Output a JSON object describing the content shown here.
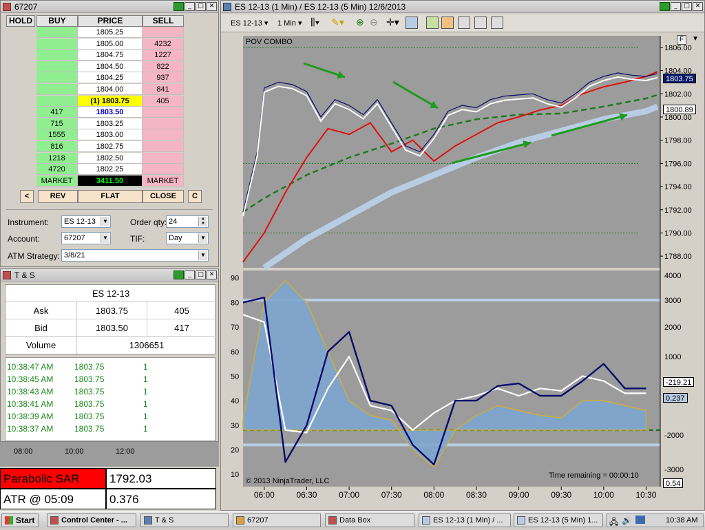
{
  "dom_window": {
    "title": "67207",
    "headers": [
      "HOLD",
      "BUY",
      "PRICE",
      "SELL"
    ],
    "rows": [
      {
        "buy": "",
        "price": "1805.25",
        "sell": ""
      },
      {
        "buy": "",
        "price": "1805.00",
        "sell": "4232"
      },
      {
        "buy": "",
        "price": "1804.75",
        "sell": "1227"
      },
      {
        "buy": "",
        "price": "1804.50",
        "sell": "822"
      },
      {
        "buy": "",
        "price": "1804.25",
        "sell": "937"
      },
      {
        "buy": "",
        "price": "1804.00",
        "sell": "841"
      },
      {
        "buy": "",
        "price": "(1) 1803.75",
        "sell": "405"
      },
      {
        "buy": "417",
        "price": "1803.50",
        "sell": ""
      },
      {
        "buy": "715",
        "price": "1803.25",
        "sell": ""
      },
      {
        "buy": "1555",
        "price": "1803.00",
        "sell": ""
      },
      {
        "buy": "816",
        "price": "1802.75",
        "sell": ""
      },
      {
        "buy": "1218",
        "price": "1802.50",
        "sell": ""
      },
      {
        "buy": "4720",
        "price": "1802.25",
        "sell": ""
      }
    ],
    "market_row": {
      "buy": "MARKET",
      "price": "3411.50",
      "sell": "MARKET"
    },
    "buttons": {
      "left": "<",
      "rev": "REV",
      "flat": "FLAT",
      "close": "CLOSE",
      "right": "C"
    },
    "instrument_label": "Instrument:",
    "instrument_value": "ES 12-13",
    "order_qty_label": "Order qty:",
    "order_qty_value": "24",
    "account_label": "Account:",
    "account_value": "67207",
    "tif_label": "TIF:",
    "tif_value": "Day",
    "atm_label": "ATM Strategy:",
    "atm_value": "3/8/21"
  },
  "ts_window": {
    "title": "T & S",
    "instrument": "ES 12-13",
    "ask_label": "Ask",
    "ask_price": "1803.75",
    "ask_size": "405",
    "bid_label": "Bid",
    "bid_price": "1803.50",
    "bid_size": "417",
    "volume_label": "Volume",
    "volume_value": "1306651",
    "trades": [
      {
        "time": "10:38:47 AM",
        "price": "1803.75",
        "size": "1"
      },
      {
        "time": "10:38:45 AM",
        "price": "1803.75",
        "size": "1"
      },
      {
        "time": "10:38:43 AM",
        "price": "1803.75",
        "size": "1"
      },
      {
        "time": "10:38:41 AM",
        "price": "1803.75",
        "size": "1"
      },
      {
        "time": "10:38:39 AM",
        "price": "1803.75",
        "size": "1"
      },
      {
        "time": "10:38:37 AM",
        "price": "1803.75",
        "size": "1"
      }
    ]
  },
  "data_box": {
    "axis_times": [
      "08:00",
      "10:00",
      "12:00"
    ],
    "psar_label": "Parabolic SAR",
    "psar_value": "1792.03",
    "atr_label": "ATR @ 05:09",
    "atr_value": "0.376"
  },
  "chart_window": {
    "title": "ES 12-13 (1 Min) / ES 12-13 (5 Min)  12/6/2013",
    "instrument": "ES 12-13",
    "interval": "1 Min",
    "indicator_label": "POV COMBO",
    "copyright": "© 2013 NinjaTrader, LLC",
    "time_remaining": "Time remaining = 00:00:10",
    "last_price": "1803.75",
    "price_tag_2": "1800.89",
    "osc_tag_1": "-219.21",
    "osc_tag_2": "0.237",
    "corner_value": "0.54",
    "colors": {
      "background": "#9c9c9c",
      "red_line": "#e01010",
      "green_dash": "#1e7a1e",
      "white_line": "#ffffff",
      "lightblue": "#b8cce4",
      "navy": "#0a0a6a",
      "arrow_up": "#1010d0",
      "arrow_down": "#e020c0"
    }
  },
  "chart_data": [
    {
      "type": "line",
      "title": "POV COMBO",
      "xlabel": "",
      "ylabel": "",
      "x_ticks": [
        "06:00",
        "06:30",
        "07:00",
        "07:30",
        "08:00",
        "08:30",
        "09:00",
        "09:30",
        "10:00",
        "10:30"
      ],
      "y_ticks": [
        1788.0,
        1790.0,
        1792.0,
        1794.0,
        1796.0,
        1798.0,
        1800.0,
        1802.0,
        1804.0,
        1806.0
      ],
      "ylim": [
        1787.0,
        1807.0
      ],
      "series": [
        {
          "name": "",
          "x": [
            "05:45",
            "05:55",
            "06:00",
            "06:10",
            "06:20",
            "06:30",
            "06:40",
            "06:50",
            "07:00",
            "07:10",
            "07:20",
            "07:30",
            "07:40",
            "07:50",
            "08:00",
            "08:10",
            "08:20",
            "08:30",
            "08:40",
            "08:50",
            "09:00",
            "09:10",
            "09:20",
            "09:30",
            "09:40",
            "09:50",
            "10:00",
            "10:10",
            "10:20",
            "10:30",
            "10:38"
          ],
          "values": [
            1791.8,
            1797.0,
            1802.5,
            1803.0,
            1802.8,
            1802.2,
            1800.0,
            1801.5,
            1801.0,
            1800.2,
            1801.5,
            1799.5,
            1797.5,
            1797.0,
            1798.5,
            1800.5,
            1801.0,
            1800.8,
            1801.5,
            1801.8,
            1801.9,
            1802.0,
            1801.5,
            1801.2,
            1802.0,
            1803.0,
            1803.5,
            1803.8,
            1803.6,
            1803.5,
            1803.75
          ]
        },
        {
          "name": "",
          "x": [
            "05:45",
            "06:00",
            "06:15",
            "06:30",
            "06:45",
            "07:00",
            "07:15",
            "07:30",
            "07:45",
            "08:00",
            "08:15",
            "08:30",
            "08:45",
            "09:00",
            "09:15",
            "09:30",
            "09:45",
            "10:00",
            "10:15",
            "10:30",
            "10:38"
          ],
          "values": [
            1787.5,
            1790.0,
            1793.5,
            1796.5,
            1799.0,
            1798.5,
            1799.5,
            1797.0,
            1798.0,
            1796.2,
            1797.5,
            1798.5,
            1799.5,
            1800.0,
            1800.6,
            1801.0,
            1802.0,
            1802.6,
            1803.0,
            1803.5,
            1803.9
          ]
        },
        {
          "name": "",
          "x": [
            "05:45",
            "06:00",
            "06:30",
            "07:00",
            "07:30",
            "08:00",
            "08:30",
            "09:00",
            "09:30",
            "10:00",
            "10:30",
            "10:38"
          ],
          "values": [
            1791.8,
            1793.0,
            1795.0,
            1796.5,
            1797.7,
            1799.0,
            1799.8,
            1800.2,
            1800.3,
            1800.9,
            1801.6,
            1801.9
          ]
        },
        {
          "name": "",
          "x": [
            "06:00",
            "06:30",
            "07:00",
            "07:30",
            "08:00",
            "08:30",
            "09:00",
            "09:30",
            "10:00",
            "10:30",
            "10:38"
          ],
          "values": [
            1787.0,
            1789.5,
            1791.5,
            1793.5,
            1795.0,
            1796.5,
            1797.8,
            1798.8,
            1799.8,
            1800.5,
            1800.89
          ]
        }
      ]
    },
    {
      "type": "area",
      "xlabel": "",
      "ylabel": "",
      "x_ticks": [
        "06:00",
        "06:30",
        "07:00",
        "07:30",
        "08:00",
        "08:30",
        "09:00",
        "09:30",
        "10:00",
        "10:30"
      ],
      "y_ticks_left": [
        10,
        20,
        30,
        40,
        50,
        60,
        70,
        80,
        90
      ],
      "y_ticks_right": [
        -3000,
        -2000,
        3000,
        2000,
        1000,
        4000
      ],
      "ylim": [
        5,
        93
      ],
      "series": [
        {
          "name": "",
          "x": [
            "05:45",
            "06:00",
            "06:15",
            "06:30",
            "06:45",
            "07:00",
            "07:15",
            "07:30",
            "07:45",
            "08:00",
            "08:15",
            "08:30",
            "08:45",
            "09:00",
            "09:15",
            "09:30",
            "09:45",
            "10:00",
            "10:15",
            "10:30"
          ],
          "values": [
            75,
            72,
            28,
            27,
            45,
            58,
            38,
            36,
            28,
            35,
            40,
            42,
            45,
            42,
            45,
            44,
            50,
            48,
            43,
            43
          ]
        },
        {
          "name": "",
          "x": [
            "05:45",
            "06:00",
            "06:15",
            "06:30",
            "06:45",
            "07:00",
            "07:15",
            "07:30",
            "07:45",
            "08:00",
            "08:15",
            "08:30",
            "08:45",
            "09:00",
            "09:15",
            "09:30",
            "09:45",
            "10:00",
            "10:15",
            "10:30"
          ],
          "values": [
            80,
            82,
            15,
            30,
            60,
            68,
            40,
            38,
            22,
            14,
            40,
            40,
            46,
            47,
            42,
            42,
            48,
            55,
            45,
            45
          ]
        },
        {
          "name": "",
          "x": [
            "05:45",
            "06:00",
            "06:15",
            "06:30",
            "06:45",
            "07:00",
            "07:15",
            "07:30",
            "07:45",
            "08:00",
            "08:15",
            "08:30",
            "08:45",
            "09:00",
            "09:15",
            "09:30",
            "09:45",
            "10:00",
            "10:15",
            "10:30"
          ],
          "values": [
            32,
            80,
            89,
            80,
            60,
            40,
            34,
            32,
            20,
            13,
            28,
            34,
            38,
            36,
            34,
            33,
            40,
            40,
            38,
            36
          ]
        }
      ]
    }
  ],
  "taskbar": {
    "start": "Start",
    "tasks": [
      "Control Center - ...",
      "T & S",
      "67207",
      "Data Box",
      "ES 12-13 (1 Min) / ...",
      "ES 12-13 (5 Min) 1..."
    ],
    "clock": "10:38 AM"
  }
}
